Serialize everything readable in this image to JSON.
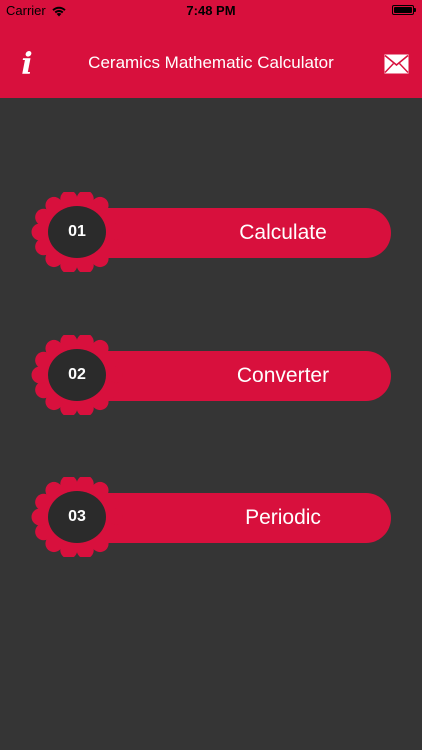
{
  "status_bar": {
    "carrier": "Carrier",
    "time": "7:48 PM"
  },
  "nav": {
    "title": "Ceramics Mathematic Calculator",
    "info_icon": "info-icon",
    "mail_icon": "mail-icon"
  },
  "menu": {
    "items": [
      {
        "number": "01",
        "label": "Calculate"
      },
      {
        "number": "02",
        "label": "Converter"
      },
      {
        "number": "03",
        "label": "Periodic"
      }
    ]
  },
  "colors": {
    "accent": "#d8103d",
    "background": "#353535",
    "badge": "#2b2b2b"
  }
}
